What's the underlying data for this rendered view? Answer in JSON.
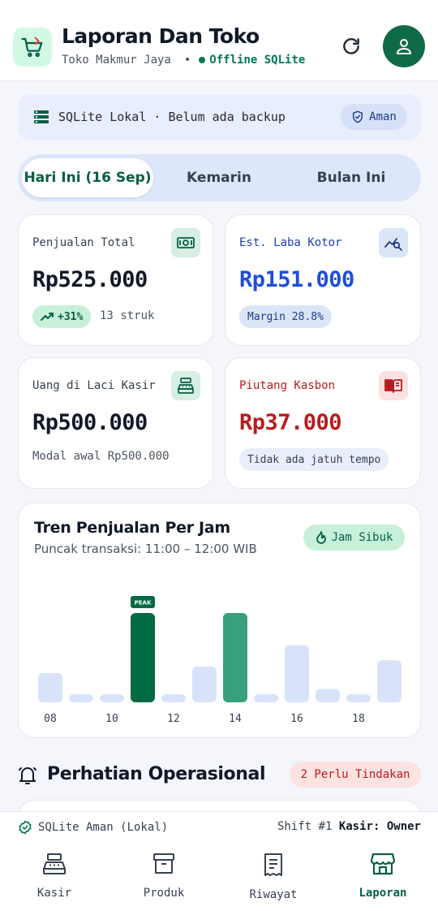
{
  "header": {
    "title": "Laporan Dan Toko",
    "store_name": "Toko Makmur Jaya",
    "separator": "•",
    "status": "Offline SQLite"
  },
  "db_bar": {
    "text": "SQLite Lokal · Belum ada backup",
    "badge": "Aman"
  },
  "tabs": [
    {
      "label": "Hari Ini (16 Sep)",
      "active": true
    },
    {
      "label": "Kemarin",
      "active": false
    },
    {
      "label": "Bulan Ini",
      "active": false
    }
  ],
  "cards": {
    "total_sales": {
      "label": "Penjualan Total",
      "value": "Rp525.000",
      "trend": "+31%",
      "receipts": "13 struk",
      "icon": "cash-icon"
    },
    "gross_profit": {
      "label": "Est. Laba Kotor",
      "value": "Rp151.000",
      "margin": "Margin 28.8%",
      "icon": "analytics-icon"
    },
    "cash_drawer": {
      "label": "Uang di Laci Kasir",
      "value": "Rp500.000",
      "note": "Modal awal Rp500.000",
      "icon": "register-icon"
    },
    "receivables": {
      "label": "Piutang Kasbon",
      "value": "Rp37.000",
      "note": "Tidak ada jatuh tempo",
      "icon": "book-icon"
    }
  },
  "chart": {
    "title": "Tren Penjualan Per Jam",
    "subtitle": "Puncak transaksi: 11:00 – 12:00 WIB",
    "badge": "Jam Sibuk",
    "peak_label": "PEAK"
  },
  "chart_data": {
    "type": "bar",
    "categories": [
      "08",
      "09",
      "10",
      "11",
      "12",
      "13",
      "14",
      "15",
      "16",
      "17",
      "18",
      "19"
    ],
    "tick_labels": [
      "08",
      "10",
      "12",
      "14",
      "16",
      "18"
    ],
    "values": [
      33,
      9,
      9,
      100,
      9,
      40,
      100,
      9,
      64,
      15,
      9,
      47
    ],
    "peak_index": 3,
    "colors": {
      "normal": "#d8e3fa",
      "peak": "#036b44",
      "secondary": "#38a07b"
    },
    "secondary_index": 6
  },
  "attention": {
    "title": "Perhatian Operasional",
    "badge": "2 Perlu Tindakan"
  },
  "status_bar": {
    "left": "SQLite Aman (Lokal)",
    "shift": "Shift #1",
    "cashier_label": "Kasir:",
    "cashier_name": "Owner"
  },
  "nav": [
    {
      "label": "Kasir",
      "icon": "cash-register-icon",
      "active": false
    },
    {
      "label": "Produk",
      "icon": "archive-box-icon",
      "active": false
    },
    {
      "label": "Riwayat",
      "icon": "receipt-icon",
      "active": false
    },
    {
      "label": "Laporan",
      "icon": "store-icon",
      "active": true
    }
  ]
}
